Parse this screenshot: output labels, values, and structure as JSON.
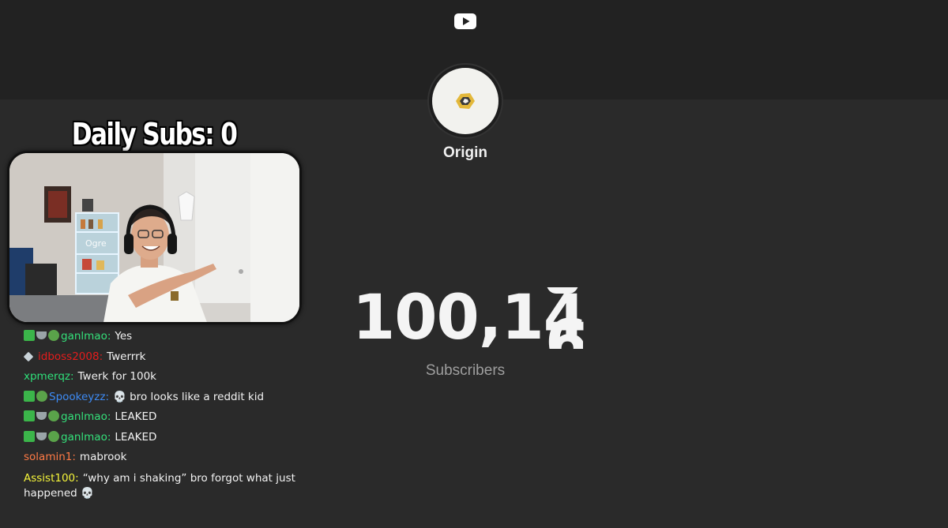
{
  "overlay": {
    "daily_subs": "Daily Subs: 0"
  },
  "channel": {
    "name": "Origin",
    "subscriber_count": "100,14",
    "last_digit": "6",
    "subscriber_label": "Subscribers"
  },
  "chat": [
    {
      "badges": [
        "green",
        "cup",
        "face"
      ],
      "user": "ganlmao",
      "sep": ":",
      "message": "Yes",
      "color": "#34e07a"
    },
    {
      "badges": [
        "diamond"
      ],
      "user": "idboss2008",
      "sep": ":",
      "message": "Twerrrk",
      "color": "#e51c1c"
    },
    {
      "badges": [],
      "user": "xpmerqz",
      "sep": ":",
      "message": "Twerk for 100k",
      "color": "#2fe07a"
    },
    {
      "badges": [
        "green",
        "face"
      ],
      "user": "Spookeyzz",
      "sep": ":",
      "message": "💀 bro looks like a reddit kid",
      "color": "#3d8bf5"
    },
    {
      "badges": [
        "green",
        "cup",
        "face"
      ],
      "user": "ganlmao",
      "sep": ":",
      "message": "LEAKED",
      "color": "#34e07a"
    },
    {
      "badges": [
        "green",
        "cup",
        "face"
      ],
      "user": "ganlmao",
      "sep": ":",
      "message": "LEAKED",
      "color": "#34e07a"
    },
    {
      "badges": [],
      "user": "solamin1",
      "sep": ":",
      "message": "mabrook",
      "color": "#ff7a45"
    },
    {
      "badges": [],
      "user": "Assist100",
      "sep": ":",
      "message": "“why am i shaking” bro forgot what just happened 💀",
      "color": "#f5f53a"
    }
  ],
  "colors": {
    "background": "#2a2a2a",
    "top_band": "#222222",
    "youtube_red": "#ffffff"
  }
}
